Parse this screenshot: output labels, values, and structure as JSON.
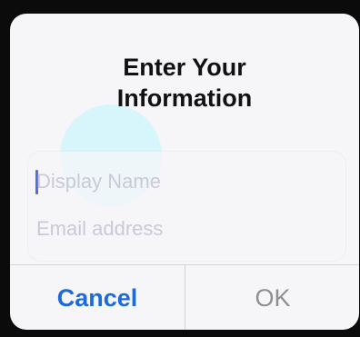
{
  "dialog": {
    "title": "Enter Your\nInformation",
    "display_name_field": {
      "value": "",
      "placeholder": "Display Name"
    },
    "email_field": {
      "value": "",
      "placeholder": "Email address"
    },
    "cancel_label": "Cancel",
    "ok_label": "OK"
  },
  "colors": {
    "accent": "#1c6bd8",
    "caret": "#4e6fe6",
    "disabled_button": "#8f8f93",
    "dialog_background": "#f6f6f8"
  }
}
